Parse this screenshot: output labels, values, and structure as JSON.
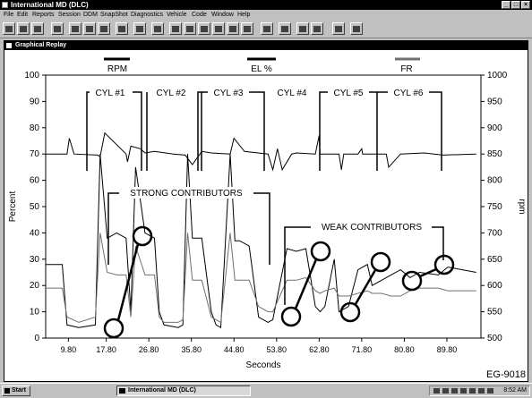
{
  "window": {
    "title": "International MD (DLC)",
    "minimize_label": "_",
    "maximize_label": "□",
    "close_label": "×"
  },
  "menu": [
    "File",
    "Edit",
    "Reports",
    "Session",
    "DDM",
    "SnapShot",
    "Diagnostics",
    "Vehicle",
    "Code",
    "Window",
    "Help"
  ],
  "toolbar_icons": [
    "open-icon",
    "save-icon",
    "print-icon",
    "monitor-icon",
    "list-icon",
    "grid-icon",
    "table-icon",
    "menu-icon",
    "meter-icon",
    "gauge-icon",
    "engine-icon",
    "wrench-icon",
    "valve-icon",
    "disk-icon",
    "record-icon",
    "chart-icon",
    "screen-icon",
    "window-icon",
    "tile-icon",
    "help-icon",
    "stop-icon"
  ],
  "inner_window": {
    "title": "Graphical Replay"
  },
  "legend": [
    {
      "name": "RPM",
      "color": "#000000"
    },
    {
      "name": "EL %",
      "color": "#000000"
    },
    {
      "name": "FR",
      "color": "#707070"
    }
  ],
  "chart_data": {
    "type": "line",
    "xlabel": "Seconds",
    "ylabel_left": "Percent",
    "ylabel_right": "rpm",
    "xlim": [
      5,
      97
    ],
    "ylim_left": [
      0,
      100
    ],
    "ylim_right": [
      500,
      1000
    ],
    "x_ticks": [
      "9.80",
      "17.80",
      "26.80",
      "35.80",
      "44.80",
      "53.80",
      "62.80",
      "71.80",
      "80.80",
      "89.80"
    ],
    "x_tick_values": [
      9.8,
      17.8,
      26.8,
      35.8,
      44.8,
      53.8,
      62.8,
      71.8,
      80.8,
      89.8
    ],
    "y_ticks_left": [
      0,
      10,
      20,
      30,
      40,
      50,
      60,
      70,
      80,
      90,
      100
    ],
    "y_ticks_right": [
      500,
      550,
      600,
      650,
      700,
      750,
      800,
      850,
      900,
      950,
      1000
    ],
    "grid": false,
    "series": [
      {
        "name": "RPM",
        "axis": "right",
        "x": [
          5,
          9.5,
          10,
          11,
          16,
          16.5,
          17.5,
          22,
          22.3,
          23,
          25,
          26,
          28,
          32,
          34.5,
          36,
          38,
          40,
          44,
          44.8,
          47,
          52,
          53,
          54,
          55,
          57,
          58,
          62,
          62.8,
          63,
          67,
          67.5,
          68,
          71,
          71.8,
          72,
          77,
          77.5,
          80,
          85,
          89,
          96
        ],
        "y": [
          850,
          850,
          880,
          850,
          848,
          845,
          890,
          850,
          835,
          865,
          860,
          852,
          855,
          850,
          848,
          830,
          855,
          852,
          850,
          880,
          855,
          850,
          820,
          860,
          820,
          850,
          852,
          850,
          885,
          850,
          850,
          820,
          850,
          850,
          860,
          850,
          850,
          825,
          850,
          852,
          848,
          850
        ]
      },
      {
        "name": "EL %",
        "axis": "left",
        "x": [
          5,
          8.5,
          9.5,
          12,
          15.5,
          16.5,
          18,
          20,
          22,
          23,
          24,
          26,
          28,
          29,
          30,
          33,
          34,
          35,
          36,
          38,
          40,
          41,
          42,
          44,
          45,
          46,
          48,
          50,
          52,
          53,
          56,
          58,
          60,
          62,
          63,
          64,
          66,
          67,
          69,
          71,
          73,
          74,
          76,
          78,
          80,
          82,
          84,
          88,
          90,
          96
        ],
        "y": [
          28,
          28,
          5,
          4,
          5,
          70,
          38,
          40,
          38,
          10,
          65,
          40,
          38,
          10,
          5,
          4,
          5,
          70,
          38,
          38,
          10,
          5,
          4,
          70,
          37,
          37,
          35,
          8,
          6,
          7,
          34,
          33,
          34,
          12,
          10,
          12,
          30,
          10,
          12,
          26,
          28,
          20,
          22,
          24,
          26,
          23,
          25,
          24,
          27,
          25
        ]
      },
      {
        "name": "FR",
        "axis": "left",
        "x": [
          5,
          8.5,
          9.5,
          12,
          15.5,
          16.5,
          18,
          20,
          22,
          23,
          24,
          26,
          28,
          29,
          30,
          33,
          34,
          35,
          36,
          38,
          40,
          41,
          42,
          44,
          45,
          46,
          48,
          50,
          52,
          53,
          56,
          58,
          60,
          62,
          63,
          64,
          66,
          67,
          69,
          71,
          73,
          74,
          76,
          78,
          80,
          82,
          84,
          88,
          90,
          96
        ],
        "y": [
          19,
          19,
          8,
          6,
          8,
          40,
          25,
          24,
          24,
          8,
          35,
          24,
          24,
          8,
          6,
          6,
          7,
          40,
          22,
          22,
          8,
          7,
          6,
          40,
          22,
          22,
          22,
          12,
          10,
          10,
          22,
          22,
          23,
          18,
          17,
          18,
          19,
          16,
          16,
          17,
          18,
          17,
          17,
          16,
          16,
          18,
          19,
          19,
          18,
          18
        ]
      }
    ],
    "annotations": {
      "cylinders": [
        "CYL #1",
        "CYL #2",
        "CYL #3",
        "CYL #4",
        "CYL #5",
        "CYL #6"
      ],
      "strong": "STRONG CONTRIBUTORS",
      "weak": "WEAK CONTRIBUTORS",
      "figure_id": "EG-9018"
    }
  },
  "taskbar": {
    "start_label": "Start",
    "app_label": "International MD (DLC)",
    "clock": "8:52 AM"
  }
}
